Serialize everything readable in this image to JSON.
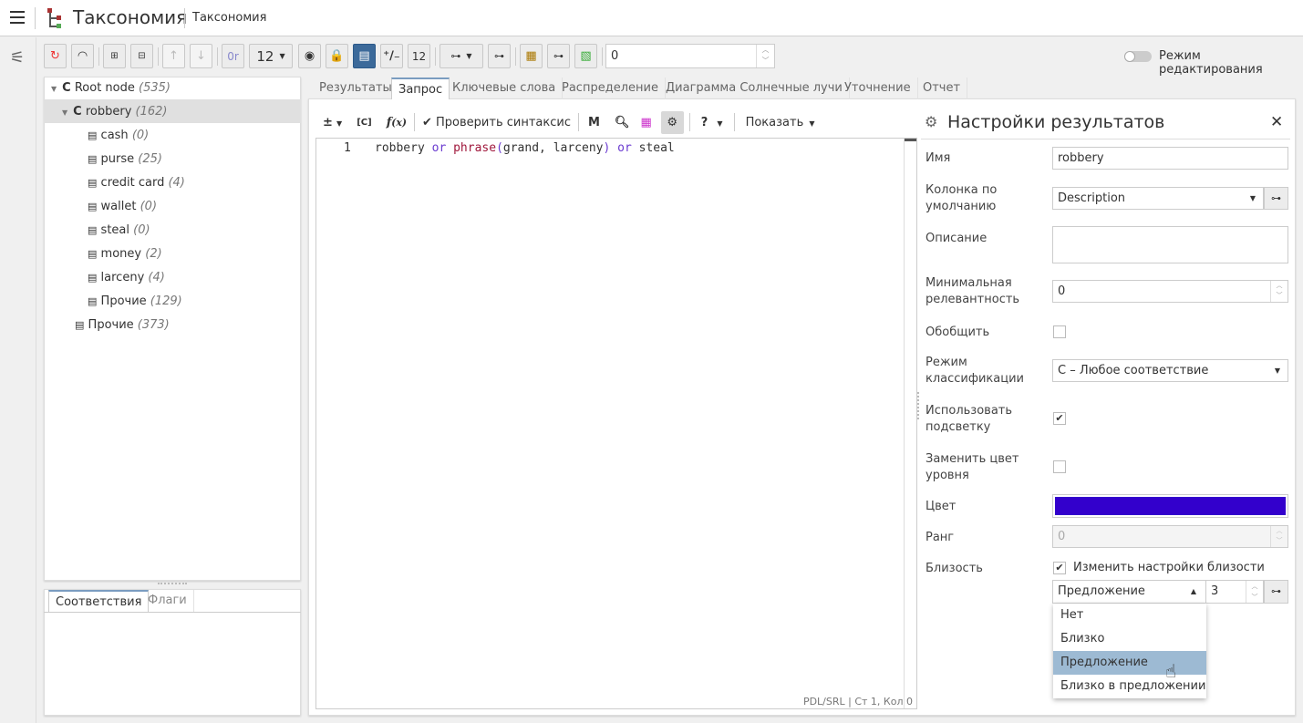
{
  "header": {
    "app_title": "Таксономия",
    "breadcrumb": "Таксономия"
  },
  "toolbar": {
    "font_size": "12",
    "counter_value": "0",
    "or_label": "0r",
    "edit_mode_label": "Режим редактирования",
    "edit_mode_on": false
  },
  "tree": {
    "items": [
      {
        "label": "Root node",
        "count": "(535)",
        "type": "C",
        "level": 0
      },
      {
        "label": "robbery",
        "count": "(162)",
        "type": "C",
        "level": 1,
        "selected": true
      },
      {
        "label": "cash",
        "count": "(0)",
        "level": 2
      },
      {
        "label": "purse",
        "count": "(25)",
        "level": 2
      },
      {
        "label": "credit card",
        "count": "(4)",
        "level": 2
      },
      {
        "label": "wallet",
        "count": "(0)",
        "level": 2
      },
      {
        "label": "steal",
        "count": "(0)",
        "level": 2
      },
      {
        "label": "money",
        "count": "(2)",
        "level": 2
      },
      {
        "label": "larceny",
        "count": "(4)",
        "level": 2
      },
      {
        "label": "Прочие",
        "count": "(129)",
        "level": 2
      },
      {
        "label": "Прочие",
        "count": "(373)",
        "level": 1
      }
    ]
  },
  "bottom_tabs": [
    "Соответствия",
    "Флаги"
  ],
  "main_tabs": [
    "Результаты",
    "Запрос",
    "Ключевые слова",
    "Распределение",
    "Диаграмма Солнечные лучи",
    "Уточнение",
    "Отчет"
  ],
  "editor_toolbar": {
    "pm": "±",
    "c": "[C]",
    "check_syntax": "Проверить синтаксис",
    "m": "M",
    "help": "?",
    "show": "Показать"
  },
  "editor": {
    "line_no": "1",
    "tokens": [
      [
        "robbery",
        ""
      ],
      [
        " or ",
        "kw"
      ],
      [
        "phrase",
        "fn"
      ],
      [
        "(",
        "kw"
      ],
      [
        "grand, larceny",
        ""
      ],
      [
        ")",
        "kw"
      ],
      [
        " or ",
        "kw"
      ],
      [
        "steal",
        ""
      ]
    ],
    "status_lang": "PDL/SRL",
    "status_pos": "Ст 1, Кол 0"
  },
  "settings": {
    "title": "Настройки результатов",
    "name_label": "Имя",
    "name_value": "robbery",
    "column_label": "Колонка по умолчанию",
    "column_value": "Description",
    "desc_label": "Описание",
    "desc_value": "",
    "minrel_label": "Минимальная релевантность",
    "minrel_value": "0",
    "generalize_label": "Обобщить",
    "generalize": false,
    "mode_label": "Режим классификации",
    "mode_value": "C – Любое соответствие",
    "highlight_label": "Использовать подсветку",
    "highlight": true,
    "replace_color_label": "Заменить цвет уровня",
    "replace_color": false,
    "color_label": "Цвет",
    "color_value": "#3300cc",
    "rank_label": "Ранг",
    "rank_value": "0",
    "proximity_label": "Близость",
    "proximity_check_label": "Изменить настройки близости",
    "proximity_check": true,
    "proximity_value": "Предложение",
    "proximity_distance": "3",
    "proximity_options": [
      "Нет",
      "Близко",
      "Предложение",
      "Близко в предложении"
    ],
    "proximity_highlighted": 2
  }
}
